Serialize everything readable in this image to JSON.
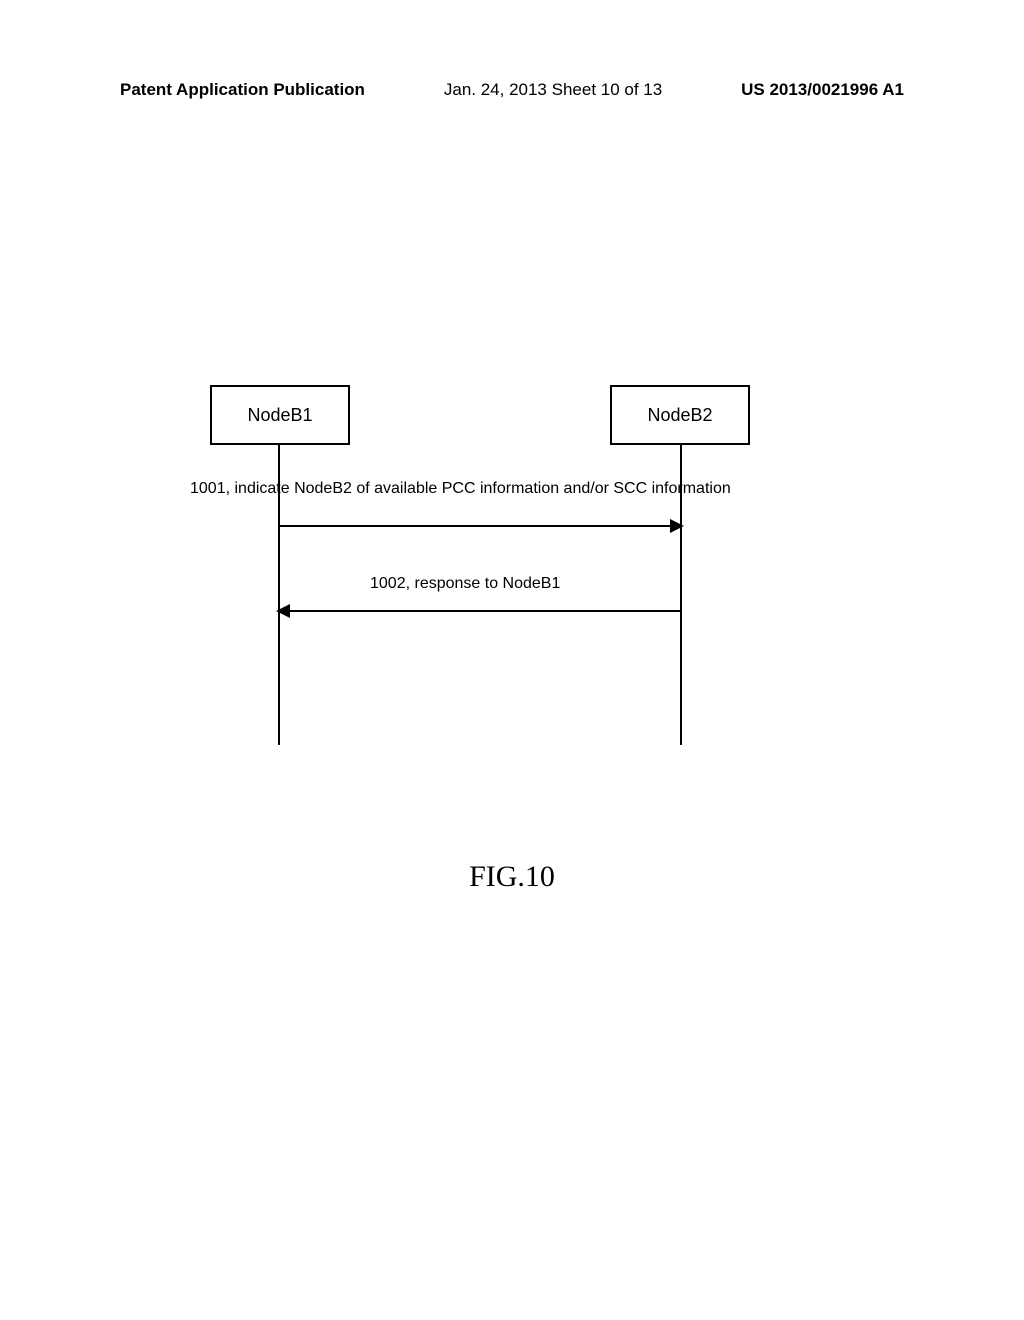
{
  "header": {
    "left": "Patent Application Publication",
    "center": "Jan. 24, 2013  Sheet 10 of 13",
    "right": "US 2013/0021996 A1"
  },
  "diagram": {
    "node1": "NodeB1",
    "node2": "NodeB2",
    "message1": "1001, indicate NodeB2 of available PCC information and/or SCC information",
    "message2": "1002, response to NodeB1"
  },
  "figure_caption": "FIG.10"
}
